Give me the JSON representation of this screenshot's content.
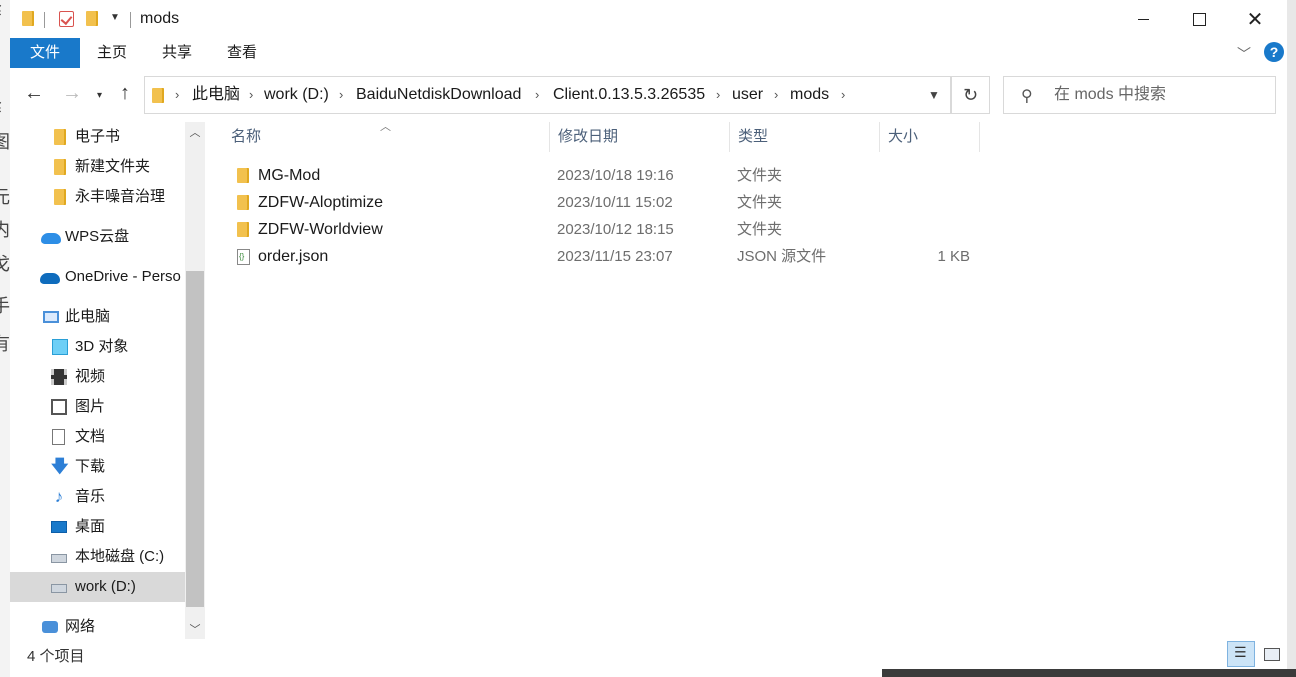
{
  "window": {
    "title": "mods"
  },
  "ribbon": {
    "tabs": [
      "文件",
      "主页",
      "共享",
      "查看"
    ],
    "help_label": "?"
  },
  "nav": {
    "back_icon": "←",
    "forward_icon": "→",
    "recent_icon": "▾",
    "up_icon": "↑",
    "breadcrumb": [
      "此电脑",
      "work (D:)",
      "BaiduNetdiskDownload",
      "Client.0.13.5.3.26535",
      "user",
      "mods"
    ],
    "refresh_icon": "↻",
    "search_placeholder": "在 mods 中搜索"
  },
  "sidebar": {
    "items": [
      {
        "label": "电子书",
        "icon": "folder-icon"
      },
      {
        "label": "新建文件夹",
        "icon": "folder-icon"
      },
      {
        "label": "永丰噪音治理",
        "icon": "folder-icon"
      },
      {
        "label": "WPS云盘",
        "icon": "cloud-icon"
      },
      {
        "label": "OneDrive - Perso",
        "icon": "onedrive-icon"
      },
      {
        "label": "此电脑",
        "icon": "computer-icon"
      },
      {
        "label": "3D 对象",
        "icon": "3d-objects-icon"
      },
      {
        "label": "视频",
        "icon": "video-icon"
      },
      {
        "label": "图片",
        "icon": "picture-icon"
      },
      {
        "label": "文档",
        "icon": "document-icon"
      },
      {
        "label": "下载",
        "icon": "download-icon"
      },
      {
        "label": "音乐",
        "icon": "music-icon"
      },
      {
        "label": "桌面",
        "icon": "desktop-icon"
      },
      {
        "label": "本地磁盘 (C:)",
        "icon": "drive-icon"
      },
      {
        "label": "work (D:)",
        "icon": "drive-icon",
        "selected": true
      },
      {
        "label": "网络",
        "icon": "network-icon"
      }
    ]
  },
  "columns": {
    "name": "名称",
    "date": "修改日期",
    "type": "类型",
    "size": "大小"
  },
  "files": [
    {
      "name": "MG-Mod",
      "date": "2023/10/18 19:16",
      "type": "文件夹",
      "size": "",
      "icon": "folder-icon"
    },
    {
      "name": "ZDFW-Aloptimize",
      "date": "2023/10/11 15:02",
      "type": "文件夹",
      "size": "",
      "icon": "folder-icon"
    },
    {
      "name": "ZDFW-Worldview",
      "date": "2023/10/12 18:15",
      "type": "文件夹",
      "size": "",
      "icon": "folder-icon"
    },
    {
      "name": "order.json",
      "date": "2023/11/15 23:07",
      "type": "JSON 源文件",
      "size": "1 KB",
      "icon": "json-file-icon"
    }
  ],
  "status": {
    "item_count": "4 个项目"
  },
  "background_text": [
    "纟",
    "图",
    "元",
    "内",
    "戈",
    "手",
    "有"
  ],
  "colors": {
    "accent": "#1979ca",
    "selected_bg": "#d9d9d9",
    "folder": "#f2c14e"
  }
}
